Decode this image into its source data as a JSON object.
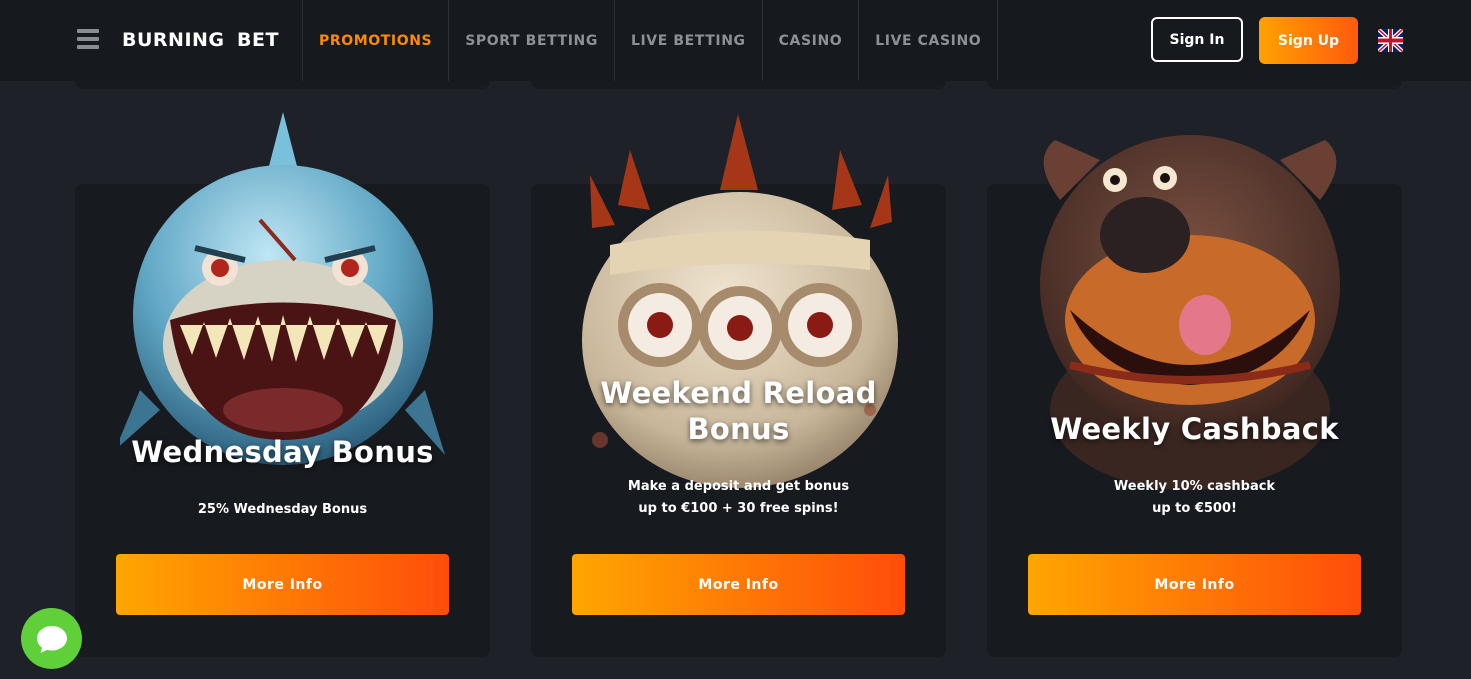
{
  "header": {
    "logo_part1": "BURNING",
    "logo_part2": "BET",
    "nav": [
      "PROMOTIONS",
      "SPORT BETTING",
      "LIVE BETTING",
      "CASINO",
      "LIVE CASINO"
    ],
    "active_nav": "PROMOTIONS",
    "signin_label": "Sign In",
    "signup_label": "Sign Up",
    "language_icon": "uk-flag-icon"
  },
  "promotions": [
    {
      "title": "Wednesday Bonus",
      "description": [
        "25% Wednesday Bonus"
      ],
      "button": "More Info",
      "character": "shark-character"
    },
    {
      "title": "Weekend Reload Bonus",
      "title_lines": [
        "Weekend Reload",
        "Bonus"
      ],
      "description": [
        "Make a deposit and get bonus",
        "up to €100 + 30 free spins!"
      ],
      "button": "More Info",
      "character": "horned-monster-character"
    },
    {
      "title": "Weekly Cashback",
      "description": [
        "Weekly 10% cashback",
        "up to €500!"
      ],
      "button": "More Info",
      "character": "bulldog-character"
    }
  ],
  "chat_icon": "chat-bubble-icon",
  "colors": {
    "accent": "#ff8a00",
    "button_gradient_start": "#ffa600",
    "button_gradient_end": "#ff4d0a",
    "background": "#1e2228",
    "card": "#171a1f",
    "chat": "#5fcf3a"
  }
}
